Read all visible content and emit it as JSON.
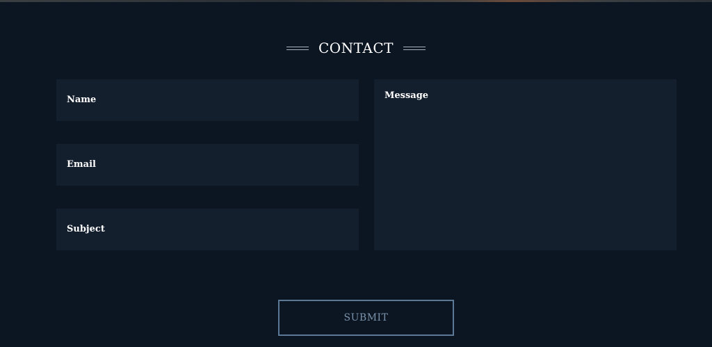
{
  "contact": {
    "title": "CONTACT",
    "fields": {
      "name_placeholder": "Name",
      "email_placeholder": "Email",
      "subject_placeholder": "Subject",
      "message_placeholder": "Message"
    },
    "submit_label": "SUBMIT"
  },
  "colors": {
    "background": "#0c1522",
    "field_background": "#141f2e",
    "button_border": "#5c7a98",
    "button_text": "#7a93ab"
  }
}
